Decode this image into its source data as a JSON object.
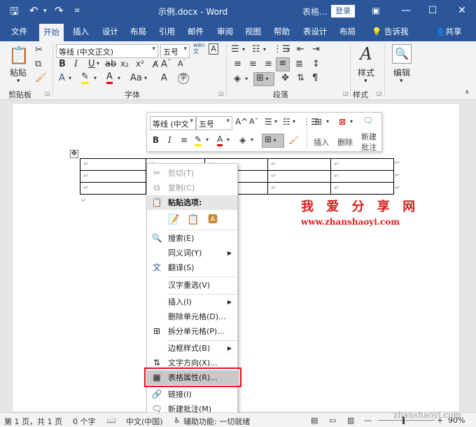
{
  "window": {
    "doc_title": "示例.docx  -  Word",
    "context_title": "表格...",
    "login": "登录"
  },
  "tabs": [
    {
      "label": "文件"
    },
    {
      "label": "开始"
    },
    {
      "label": "插入"
    },
    {
      "label": "设计"
    },
    {
      "label": "布局"
    },
    {
      "label": "引用"
    },
    {
      "label": "邮件"
    },
    {
      "label": "审阅"
    },
    {
      "label": "视图"
    },
    {
      "label": "帮助"
    },
    {
      "label": "表设计"
    },
    {
      "label": "布局"
    }
  ],
  "tellme": "告诉我",
  "share": "共享",
  "ribbon": {
    "paste_label": "粘贴",
    "font_name": "等线 (中文正文)",
    "font_size": "五号",
    "wen_label": "wén",
    "style_label": "样式",
    "edit_label": "编辑",
    "groups": {
      "clipboard": "剪贴板",
      "font": "字体",
      "paragraph": "段落",
      "styles": "样式"
    }
  },
  "minitoolbar": {
    "font_name": "等线 (中文",
    "font_size": "五号",
    "insert_label": "插入",
    "delete_label": "删除",
    "comment_label_1": "新建",
    "comment_label_2": "批注"
  },
  "table": {
    "rows": 3,
    "cell_mark": "↵"
  },
  "context_menu": {
    "items": [
      {
        "label": "剪切(T)",
        "disabled": true
      },
      {
        "label": "复制(C)",
        "disabled": true
      },
      {
        "label": "粘贴选项:"
      },
      {
        "label": "搜索(E)"
      },
      {
        "label": "同义词(Y)"
      },
      {
        "label": "翻译(S)"
      },
      {
        "label": "汉字重选(V)"
      },
      {
        "label": "插入(I)"
      },
      {
        "label": "删除单元格(D)..."
      },
      {
        "label": "拆分单元格(P)..."
      },
      {
        "label": "边框样式(B)"
      },
      {
        "label": "文字方向(X)..."
      },
      {
        "label": "表格属性(R)..."
      },
      {
        "label": "链接(I)"
      },
      {
        "label": "新建批注(M)"
      }
    ]
  },
  "watermark": {
    "title": "我 爱 分 享 网",
    "url": "www.zhanshaoyi.com",
    "corner": "zhanshaoyi.com"
  },
  "status": {
    "page": "第 1 页，共 1 页",
    "words": "0 个字",
    "language": "中文(中国)",
    "accessibility": "辅助功能: 一切就绪",
    "zoom": "90%"
  },
  "colors": {
    "brand": "#2b579a",
    "highlight_red": "#e0141e",
    "watermark_red": "#d81e1e"
  }
}
